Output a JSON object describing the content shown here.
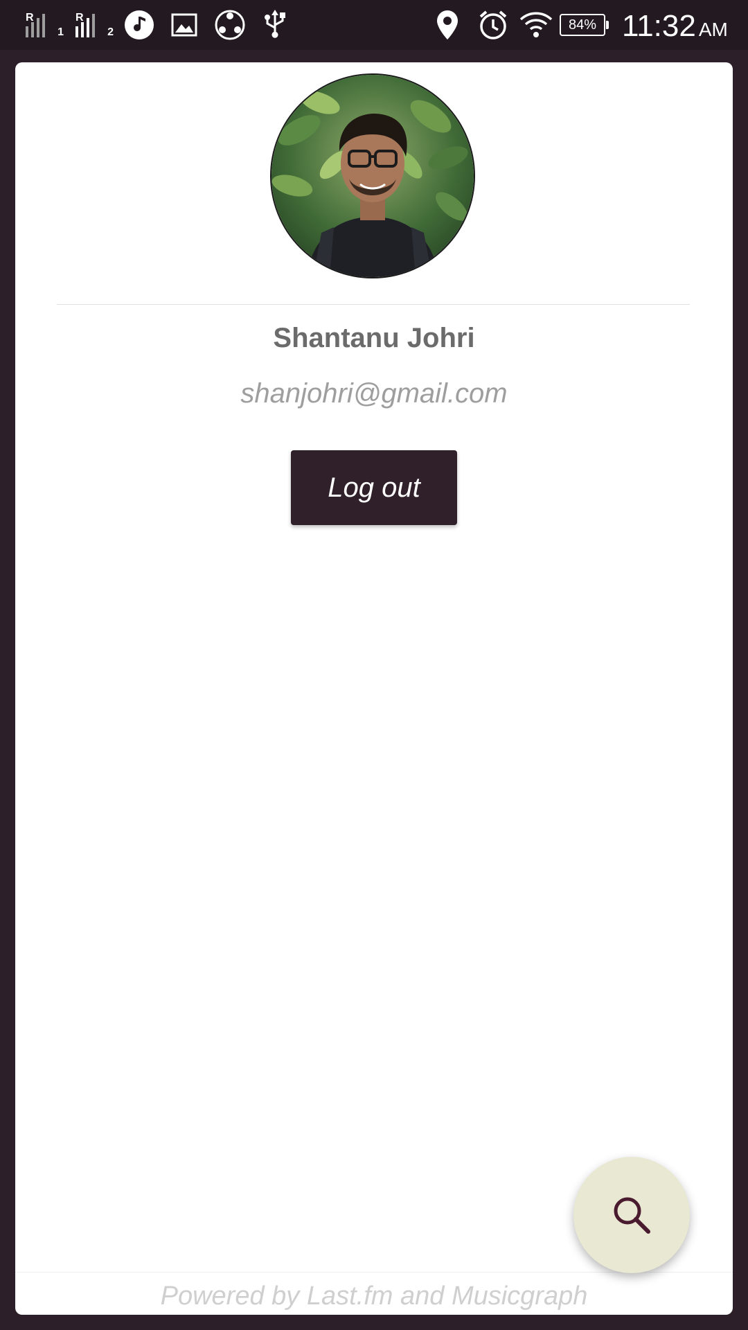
{
  "status_bar": {
    "sim1_label": "1",
    "sim2_label": "2",
    "battery_percent": "84%",
    "time": "11:32",
    "ampm": "AM",
    "icons": [
      "signal-sim1-icon",
      "signal-sim2-icon",
      "music-icon",
      "gallery-icon",
      "share-it-icon",
      "usb-icon",
      "location-icon",
      "alarm-icon",
      "wifi-icon",
      "battery-icon"
    ]
  },
  "profile": {
    "name": "Shantanu Johri",
    "email": "shanjohri@gmail.com",
    "logout_label": "Log out"
  },
  "footer": {
    "text": "Powered by Last.fm and Musicgraph"
  },
  "fab": {
    "icon": "search-icon"
  },
  "colors": {
    "background": "#2d1f29",
    "status_bar": "#231a21",
    "card": "#ffffff",
    "button": "#2f2029",
    "fab": "#e9e8d3",
    "fab_icon": "#4a1a2e"
  }
}
